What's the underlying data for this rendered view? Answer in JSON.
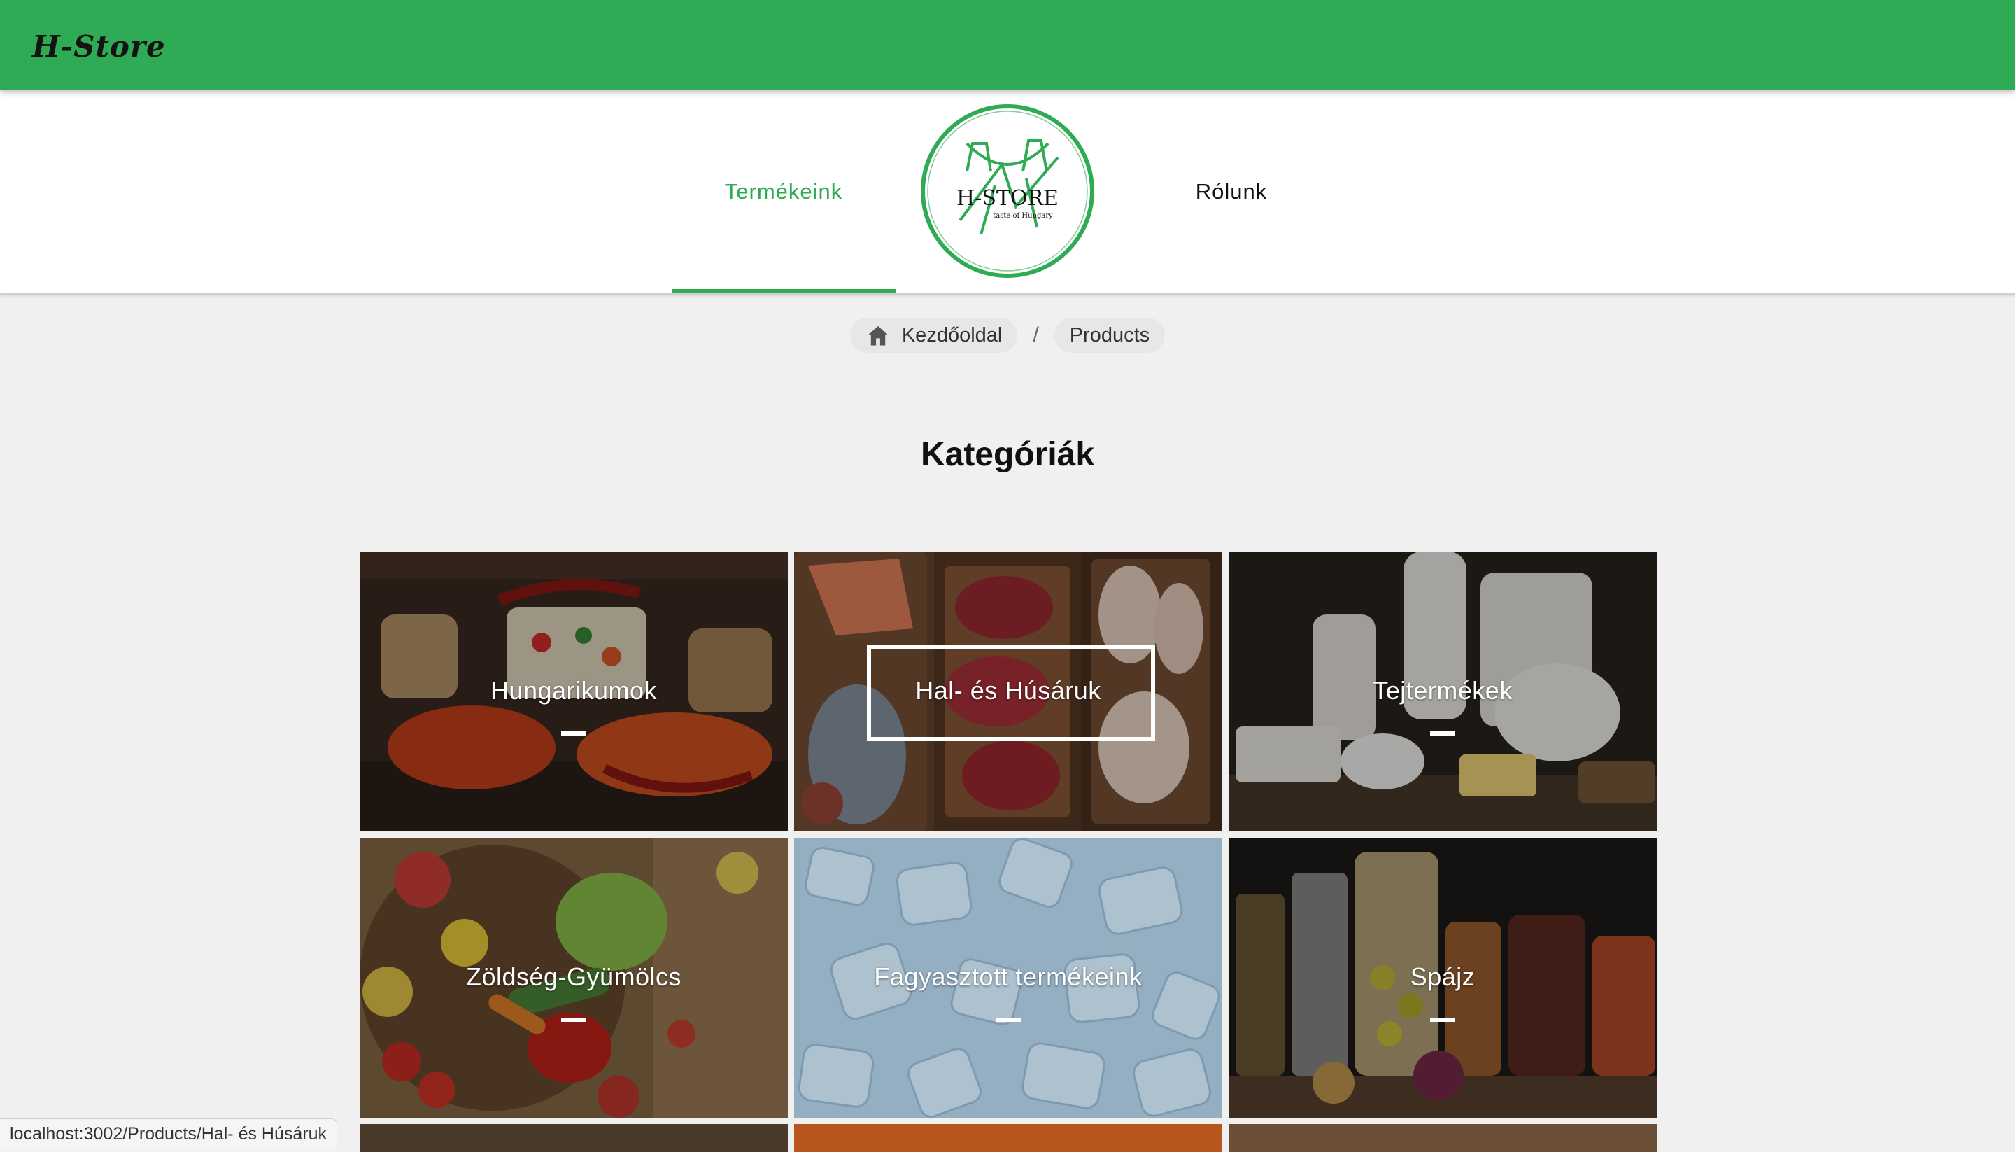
{
  "header": {
    "brand": "H-Store"
  },
  "nav": {
    "products_label": "Termékeink",
    "about_label": "Rólunk",
    "logo_text": "H-STORE",
    "logo_tagline": "taste of Hungary"
  },
  "breadcrumb": {
    "home_label": "Kezdőoldal",
    "separator": "/",
    "current_label": "Products"
  },
  "section": {
    "title": "Kategóriák"
  },
  "categories": [
    {
      "label": "Hungarikumok"
    },
    {
      "label": "Hal- és Húsáruk"
    },
    {
      "label": "Tejtermékek"
    },
    {
      "label": "Zöldség-Gyümölcs"
    },
    {
      "label": "Fagyasztott termékeink"
    },
    {
      "label": "Spájz"
    }
  ],
  "status": {
    "url": "localhost:3002/Products/Hal- és Húsáruk"
  },
  "colors": {
    "accent": "#2eab54"
  }
}
